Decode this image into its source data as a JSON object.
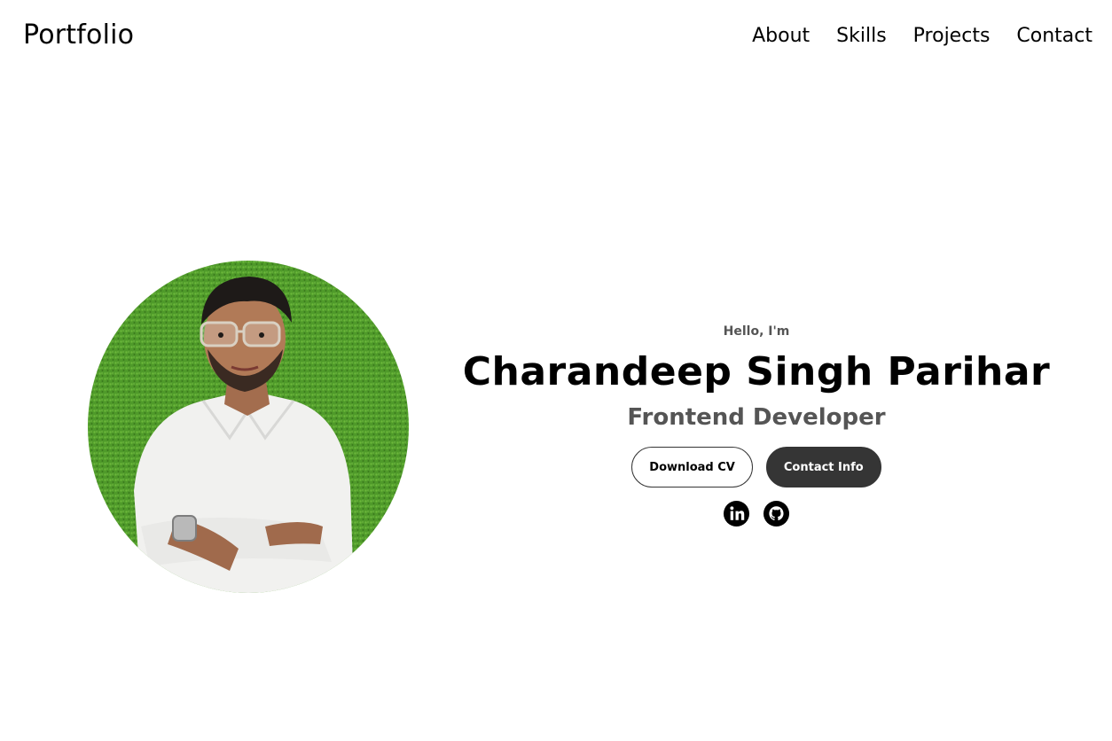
{
  "nav": {
    "logo": "Portfolio",
    "links": [
      "About",
      "Skills",
      "Projects",
      "Contact"
    ]
  },
  "hero": {
    "greeting": "Hello, I'm",
    "name": "Charandeep Singh Parihar",
    "role": "Frontend Developer",
    "buttons": {
      "download_cv": "Download CV",
      "contact_info": "Contact Info"
    },
    "socials": [
      "linkedin-icon",
      "github-icon"
    ]
  },
  "colors": {
    "button_dark": "#353535",
    "subtitle": "#555555",
    "photo_background": "#4f9a2a"
  }
}
